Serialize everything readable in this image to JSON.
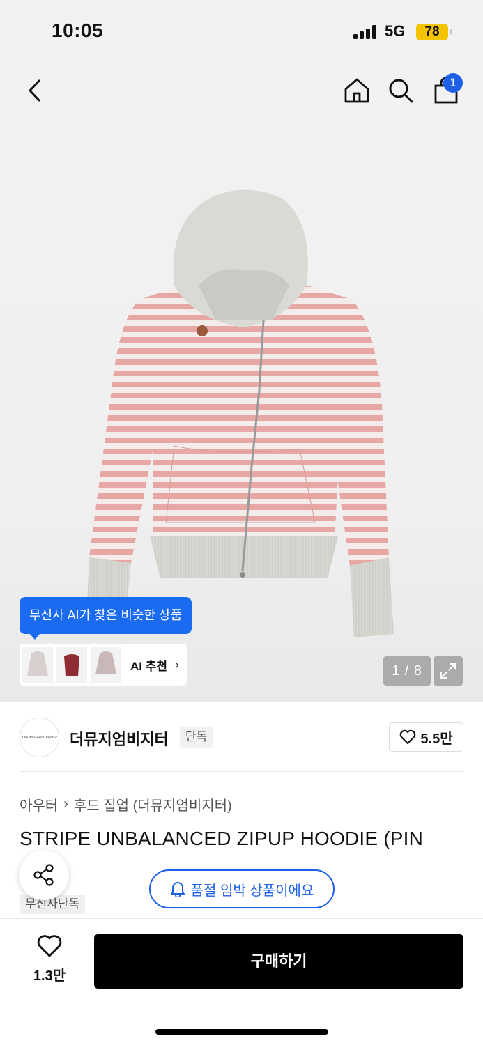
{
  "status_bar": {
    "time": "10:05",
    "network": "5G",
    "battery": "78"
  },
  "header": {
    "back_icon": "chevron-left-icon",
    "home_icon": "home-icon",
    "search_icon": "search-icon",
    "cart_icon": "shopping-bag-icon",
    "cart_badge": "1",
    "accent_color": "#1d5fe6"
  },
  "gallery": {
    "ai_tooltip": "무신사 AI가 찾은 비슷한 상품",
    "ai_recommend_label": "AI 추천",
    "ai_recommend_chevron": "›",
    "counter": "1 / 8",
    "expand_icon": "expand-icon"
  },
  "brand": {
    "name": "더뮤지엄비지터",
    "logo_text": "The Museum Visitor",
    "tag": "단독",
    "likes": "5.5만"
  },
  "breadcrumb": {
    "category": "아우터",
    "separator": "›",
    "subcategory": "후드 집업 (더뮤지엄비지터)"
  },
  "product": {
    "title": "STRIPE UNBALANCED ZIPUP HOODIE (PIN",
    "exclusive_tag": "무신사단독",
    "soldout_notice": "품절 임박 상품이에요"
  },
  "bottom_bar": {
    "wish_count": "1.3만",
    "buy_label": "구매하기"
  }
}
